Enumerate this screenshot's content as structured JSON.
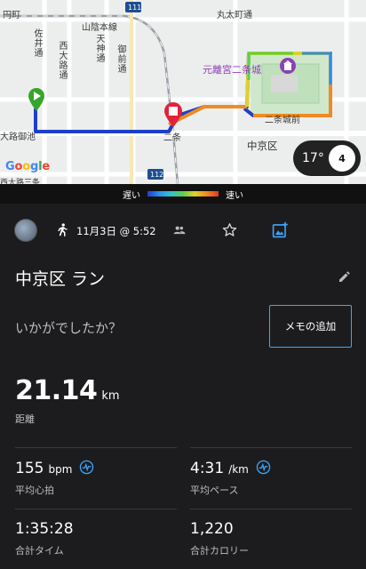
{
  "map": {
    "labels": {
      "enmachi": "円町",
      "sanin_line": "山陰本線",
      "marutamachi": "丸太町通",
      "saiin": "佐井通",
      "nishioji": "西大路通",
      "tenjin": "天神通",
      "onmae": "御前通",
      "nijo_castle": "元離宮二条城",
      "nijojo_mae": "二条城前",
      "nijo_station": "二条",
      "nakagyo": "中京区",
      "oji_oike": "大路御池",
      "nishiojisanjo": "西大路三条",
      "route_111": "111",
      "route_112": "112"
    },
    "google": "Google",
    "weather": {
      "temp": "17°",
      "wind": "4"
    }
  },
  "legend": {
    "slow": "遅い",
    "fast": "速い"
  },
  "activity": {
    "date": "11月3日 @ 5:52",
    "title": "中京区 ラン",
    "question": "いかがでしたか？",
    "memo_button": "メモの追加",
    "distance": {
      "value": "21.14",
      "unit": "km",
      "label": "距離"
    },
    "stats": {
      "heart_rate": {
        "value": "155",
        "unit": "bpm",
        "label": "平均心拍"
      },
      "pace": {
        "value": "4:31",
        "unit": "/km",
        "label": "平均ペース"
      },
      "time": {
        "value": "1:35:28",
        "label": "合計タイム"
      },
      "calories": {
        "value": "1,220",
        "label": "合計カロリー"
      }
    }
  },
  "colors": {
    "accent": "#3ea6ff",
    "background": "#1c1c1e",
    "route_blue": "#1f3fc7"
  }
}
